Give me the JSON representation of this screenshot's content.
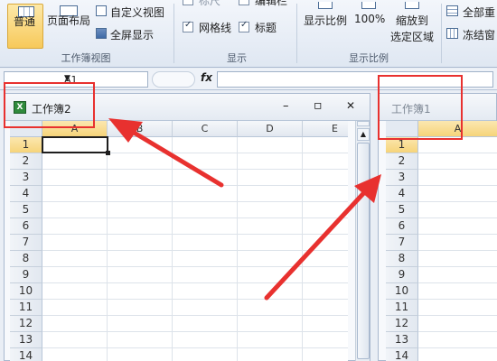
{
  "ribbon": {
    "normal_label": "普通",
    "page_layout_label": "页面布局",
    "custom_view_label": "自定义视图",
    "fullscreen_label": "全屏显示",
    "workbook_views_group": "工作簿视图",
    "show_group": "显示",
    "ruler_label": "标尺",
    "formula_bar_label": "编辑栏",
    "gridlines_label": "网格线",
    "headings_label": "标题",
    "zoom_label": "显示比例",
    "zoom100_label": "100%",
    "zoom_selection_label_line1": "缩放到",
    "zoom_selection_label_line2": "选定区域",
    "zoom_group": "显示比例",
    "arrange_all_label": "全部重",
    "freeze_label": "冻结窗"
  },
  "formula_bar": {
    "name_box": "A1",
    "fx": "fx",
    "value": ""
  },
  "window1": {
    "title": "工作簿2",
    "columns": [
      "A",
      "B",
      "C",
      "D",
      "E"
    ],
    "rows": [
      "1",
      "2",
      "3",
      "4",
      "5",
      "6",
      "7",
      "8",
      "9",
      "10",
      "11",
      "12",
      "13",
      "14"
    ],
    "minimize": "–",
    "restore": "▫",
    "close": "✕"
  },
  "window2": {
    "title": "工作簿1",
    "columns": [
      "A"
    ],
    "rows": [
      "1",
      "2",
      "3",
      "4",
      "5",
      "6",
      "7",
      "8",
      "9",
      "10",
      "11",
      "12",
      "13",
      "14"
    ]
  },
  "colors": {
    "accent_red": "#e8312f",
    "selected_header": "#f6d47a"
  }
}
